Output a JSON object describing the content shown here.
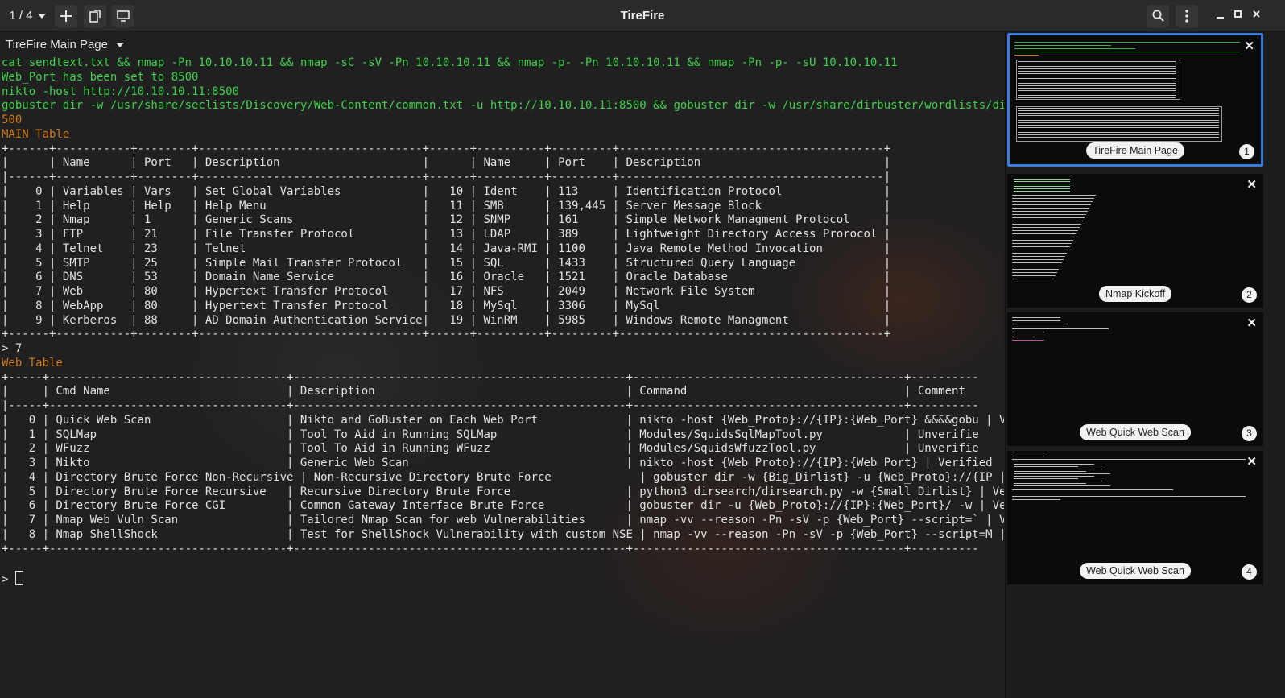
{
  "window": {
    "title": "TireFire",
    "tab_counter": "1 / 4"
  },
  "tab": {
    "title": "TireFire Main Page"
  },
  "terminal": {
    "lines": [
      {
        "text": "cat sendtext.txt && nmap -Pn 10.10.10.11 && nmap -sC -sV -Pn 10.10.10.11 && nmap -p- -Pn 10.10.10.11 && nmap -Pn -p- -sU 10.10.10.11",
        "color": "green"
      },
      {
        "text": "Web_Port has been set to 8500",
        "color": "green"
      },
      {
        "text": "nikto -host http://10.10.10.11:8500",
        "color": "green"
      },
      {
        "text": "gobuster dir -w /usr/share/seclists/Discovery/Web-Content/common.txt -u http://10.10.10.11:8500 && gobuster dir -w /usr/share/dirbuster/wordlists/directory-lis",
        "color": "green"
      },
      {
        "text": "500",
        "color": "orange"
      },
      {
        "text": "MAIN Table",
        "color": "orange"
      },
      {
        "text": "+------+-----------+--------+---------------------------------+------+----------+---------+---------------------------------------+",
        "color": "white"
      },
      {
        "text": "|      | Name      | Port   | Description                     |      | Name     | Port    | Description                           |",
        "color": "white"
      },
      {
        "text": "|------+-----------+--------+---------------------------------+------+----------+---------+---------------------------------------|",
        "color": "white"
      },
      {
        "text": "|    0 | Variables | Vars   | Set Global Variables            |   10 | Ident    | 113     | Identification Protocol               |",
        "color": "white"
      },
      {
        "text": "|    1 | Help      | Help   | Help Menu                       |   11 | SMB      | 139,445 | Server Message Block                  |",
        "color": "white"
      },
      {
        "text": "|    2 | Nmap      | 1      | Generic Scans                   |   12 | SNMP     | 161     | Simple Network Managment Protocol     |",
        "color": "white"
      },
      {
        "text": "|    3 | FTP       | 21     | File Transfer Protocol          |   13 | LDAP     | 389     | Lightweight Directory Access Prorocol |",
        "color": "white"
      },
      {
        "text": "|    4 | Telnet    | 23     | Telnet                          |   14 | Java-RMI | 1100    | Java Remote Method Invocation         |",
        "color": "white"
      },
      {
        "text": "|    5 | SMTP      | 25     | Simple Mail Transfer Protocol   |   15 | SQL      | 1433    | Structured Query Language             |",
        "color": "white"
      },
      {
        "text": "|    6 | DNS       | 53     | Domain Name Service             |   16 | Oracle   | 1521    | Oracle Database                       |",
        "color": "white"
      },
      {
        "text": "|    7 | Web       | 80     | Hypertext Transfer Protocol     |   17 | NFS      | 2049    | Network File System                   |",
        "color": "white"
      },
      {
        "text": "|    8 | WebApp    | 80     | Hypertext Transfer Protocol     |   18 | MySql    | 3306    | MySql                                 |",
        "color": "white"
      },
      {
        "text": "|    9 | Kerberos  | 88     | AD Domain Authentication Service|   19 | WinRM    | 5985    | Windows Remote Managment              |",
        "color": "white"
      },
      {
        "text": "+------+-----------+--------+---------------------------------+------+----------+---------+---------------------------------------+",
        "color": "white"
      },
      {
        "text": "> 7",
        "color": "white"
      },
      {
        "text": "Web Table",
        "color": "orange"
      },
      {
        "text": "+-----+-----------------------------------+-------------------------------------------------+----------------------------------------+----------",
        "color": "white"
      },
      {
        "text": "|     | Cmd Name                          | Description                                     | Command                                | Comment  ",
        "color": "white"
      },
      {
        "text": "|-----+-----------------------------------+-------------------------------------------------+----------------------------------------+----------",
        "color": "white"
      },
      {
        "text": "|   0 | Quick Web Scan                    | Nikto and GoBuster on Each Web Port             | nikto -host {Web_Proto}://{IP}:{Web_Port} &&&&gobu | Verified ",
        "color": "white"
      },
      {
        "text": "|   1 | SQLMap                            | Tool To Aid in Running SQLMap                   | Modules/SquidsSqlMapTool.py            | Unverifie",
        "color": "white"
      },
      {
        "text": "|   2 | WFuzz                             | Tool To Aid in Running WFuzz                    | Modules/SquidsWfuzzTool.py             | Unverifie",
        "color": "white"
      },
      {
        "text": "|   3 | Nikto                             | Generic Web Scan                                | nikto -host {Web_Proto}://{IP}:{Web_Port} | Verified ",
        "color": "white"
      },
      {
        "text": "|   4 | Directory Brute Force Non-Recursive | Non-Recursive Directory Brute Force             | gobuster dir -w {Big_Dirlist} -u {Web_Proto}://{IP | Verified ",
        "color": "white"
      },
      {
        "text": "|   5 | Directory Brute Force Recursive   | Recursive Directory Brute Force                 | python3 dirsearch/dirsearch.py -w {Small_Dirlist} | Verified ",
        "color": "white"
      },
      {
        "text": "|   6 | Directory Brute Force CGI         | Common Gateway Interface Brute Force            | gobuster dir -u {Web_Proto}://{IP}:{Web_Port}/ -w | Verified ",
        "color": "white"
      },
      {
        "text": "|   7 | Nmap Web Vuln Scan                | Tailored Nmap Scan for web Vulnerabilities      | nmap -vv --reason -Pn -sV -p {Web_Port} --script=` | Verified ",
        "color": "white"
      },
      {
        "text": "|   8 | Nmap ShellShock                   | Test for ShellShock Vulnerability with custom NSE | nmap -vv --reason -Pn -sV -p {Web_Port} --script=M | Verified ",
        "color": "white"
      },
      {
        "text": "+-----+-----------------------------------+-------------------------------------------------+----------------------------------------+----------",
        "color": "white"
      },
      {
        "text": "",
        "color": "white"
      },
      {
        "text": "> ",
        "color": "white",
        "cursor": true
      }
    ]
  },
  "thumbnails": [
    {
      "label": "TireFire Main Page",
      "number": "1",
      "active": true
    },
    {
      "label": "Nmap Kickoff",
      "number": "2",
      "active": false
    },
    {
      "label": "Web Quick Web Scan",
      "number": "3",
      "active": false
    },
    {
      "label": "Web Quick Web Scan",
      "number": "4",
      "active": false
    }
  ],
  "colors": {
    "green": "#3fd14a",
    "orange": "#d07a1c",
    "white": "#e2e2e2",
    "accent": "#3a7be0"
  },
  "icons": {
    "tab_dropdown": "chevron-down-icon",
    "new_tab": "plus-icon",
    "detach": "detach-tab-icon",
    "overview": "tab-overview-icon",
    "search": "search-icon",
    "menu": "kebab-menu-icon",
    "minimize": "minimize-icon",
    "maximize": "maximize-icon",
    "close": "close-icon"
  }
}
